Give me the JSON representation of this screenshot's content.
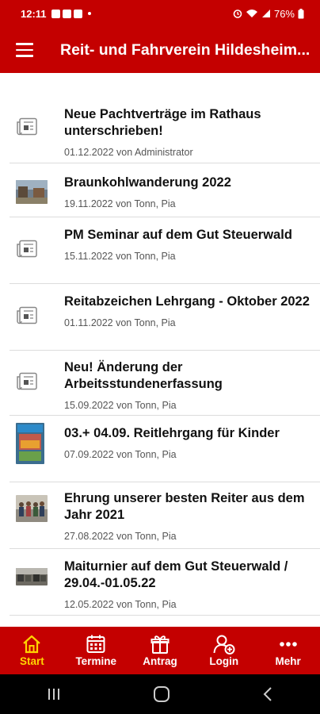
{
  "status_bar": {
    "time": "12:11",
    "battery": "76%"
  },
  "app_bar": {
    "title": "Reit- und Fahrverein Hildesheim..."
  },
  "news": [
    {
      "title": "Neue Pachtverträge im Rathaus unterschrieben!",
      "meta": "01.12.2022 von Administrator",
      "icon": "document-icon"
    },
    {
      "title": "Braunkohlwanderung 2022",
      "meta": "19.11.2022 von Tonn, Pia",
      "icon": "photo-thumbnail"
    },
    {
      "title": "PM Seminar auf dem Gut Steuerwald",
      "meta": "15.11.2022 von Tonn, Pia",
      "icon": "document-icon"
    },
    {
      "title": "Reitabzeichen Lehrgang - Oktober 2022",
      "meta": "01.11.2022 von Tonn, Pia",
      "icon": "document-icon"
    },
    {
      "title": "Neu! Änderung der Arbeitsstundenerfassung",
      "meta": "15.09.2022 von Tonn, Pia",
      "icon": "document-icon"
    },
    {
      "title": "03.+ 04.09. Reitlehrgang für Kinder",
      "meta": "07.09.2022 von Tonn, Pia",
      "icon": "poster-thumbnail"
    },
    {
      "title": "Ehrung unserer besten Reiter aus dem Jahr 2021",
      "meta": "27.08.2022 von Tonn, Pia",
      "icon": "group-photo-thumbnail"
    },
    {
      "title": "Maiturnier auf dem Gut Steuerwald / 29.04.-01.05.22",
      "meta": "12.05.2022 von Tonn, Pia",
      "icon": "event-photo-thumbnail"
    }
  ],
  "bottom_nav": [
    {
      "label": "Start",
      "icon": "home-icon",
      "active": true
    },
    {
      "label": "Termine",
      "icon": "calendar-icon",
      "active": false
    },
    {
      "label": "Antrag",
      "icon": "gift-icon",
      "active": false
    },
    {
      "label": "Login",
      "icon": "user-add-icon",
      "active": false
    },
    {
      "label": "Mehr",
      "icon": "more-icon",
      "active": false
    }
  ],
  "colors": {
    "primary": "#c40000",
    "active_nav": "#ffd400",
    "text": "#111111",
    "meta": "#555555"
  }
}
